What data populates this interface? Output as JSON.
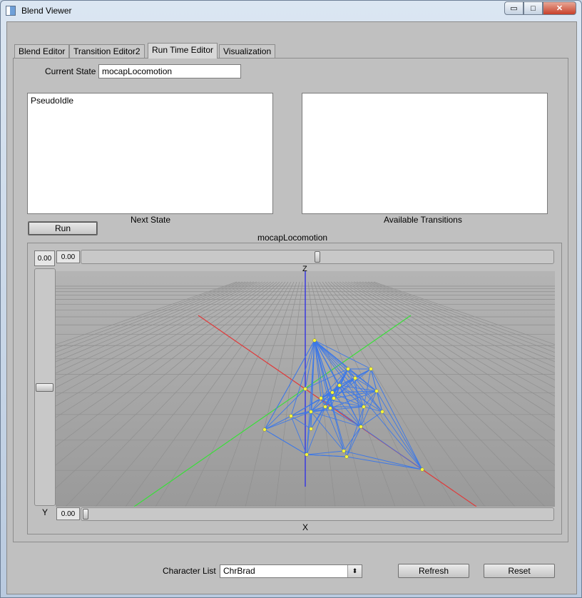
{
  "window": {
    "title": "Blend Viewer",
    "min_glyph": "▭",
    "max_glyph": "□",
    "close_glyph": "✕"
  },
  "tabs": [
    {
      "label": "Blend Editor"
    },
    {
      "label": "Transition Editor2"
    },
    {
      "label": "Run Time Editor"
    },
    {
      "label": "Visualization"
    }
  ],
  "active_tab": "Run Time Editor",
  "current_state": {
    "label": "Current State",
    "value": "mocapLocomotion"
  },
  "next_state": {
    "label": "Next State",
    "items": [
      "PseudoIdle"
    ]
  },
  "available_transitions": {
    "label": "Available Transitions",
    "items": []
  },
  "run_button": {
    "label": "Run"
  },
  "graph": {
    "title": "mocapLocomotion",
    "z_value": "0.00",
    "y_value": "0.00",
    "x_value": "0.00",
    "z_label": "Z",
    "y_label": "Y",
    "x_label": "X",
    "slider_levels": {
      "z": 0.5,
      "y": 0.5,
      "x": 0.0
    },
    "colors": {
      "x_axis": "#e03a3a",
      "y_axis": "#3adf3a",
      "z_axis": "#3a3ae0",
      "mesh": "#3c78e8",
      "point": "#f4f43c",
      "floor": "#9c9c9c"
    }
  },
  "character_list": {
    "label": "Character List",
    "value": "ChrBrad",
    "arrow_glyph": "⬍"
  },
  "refresh_button": {
    "label": "Refresh"
  },
  "reset_button": {
    "label": "Reset"
  }
}
